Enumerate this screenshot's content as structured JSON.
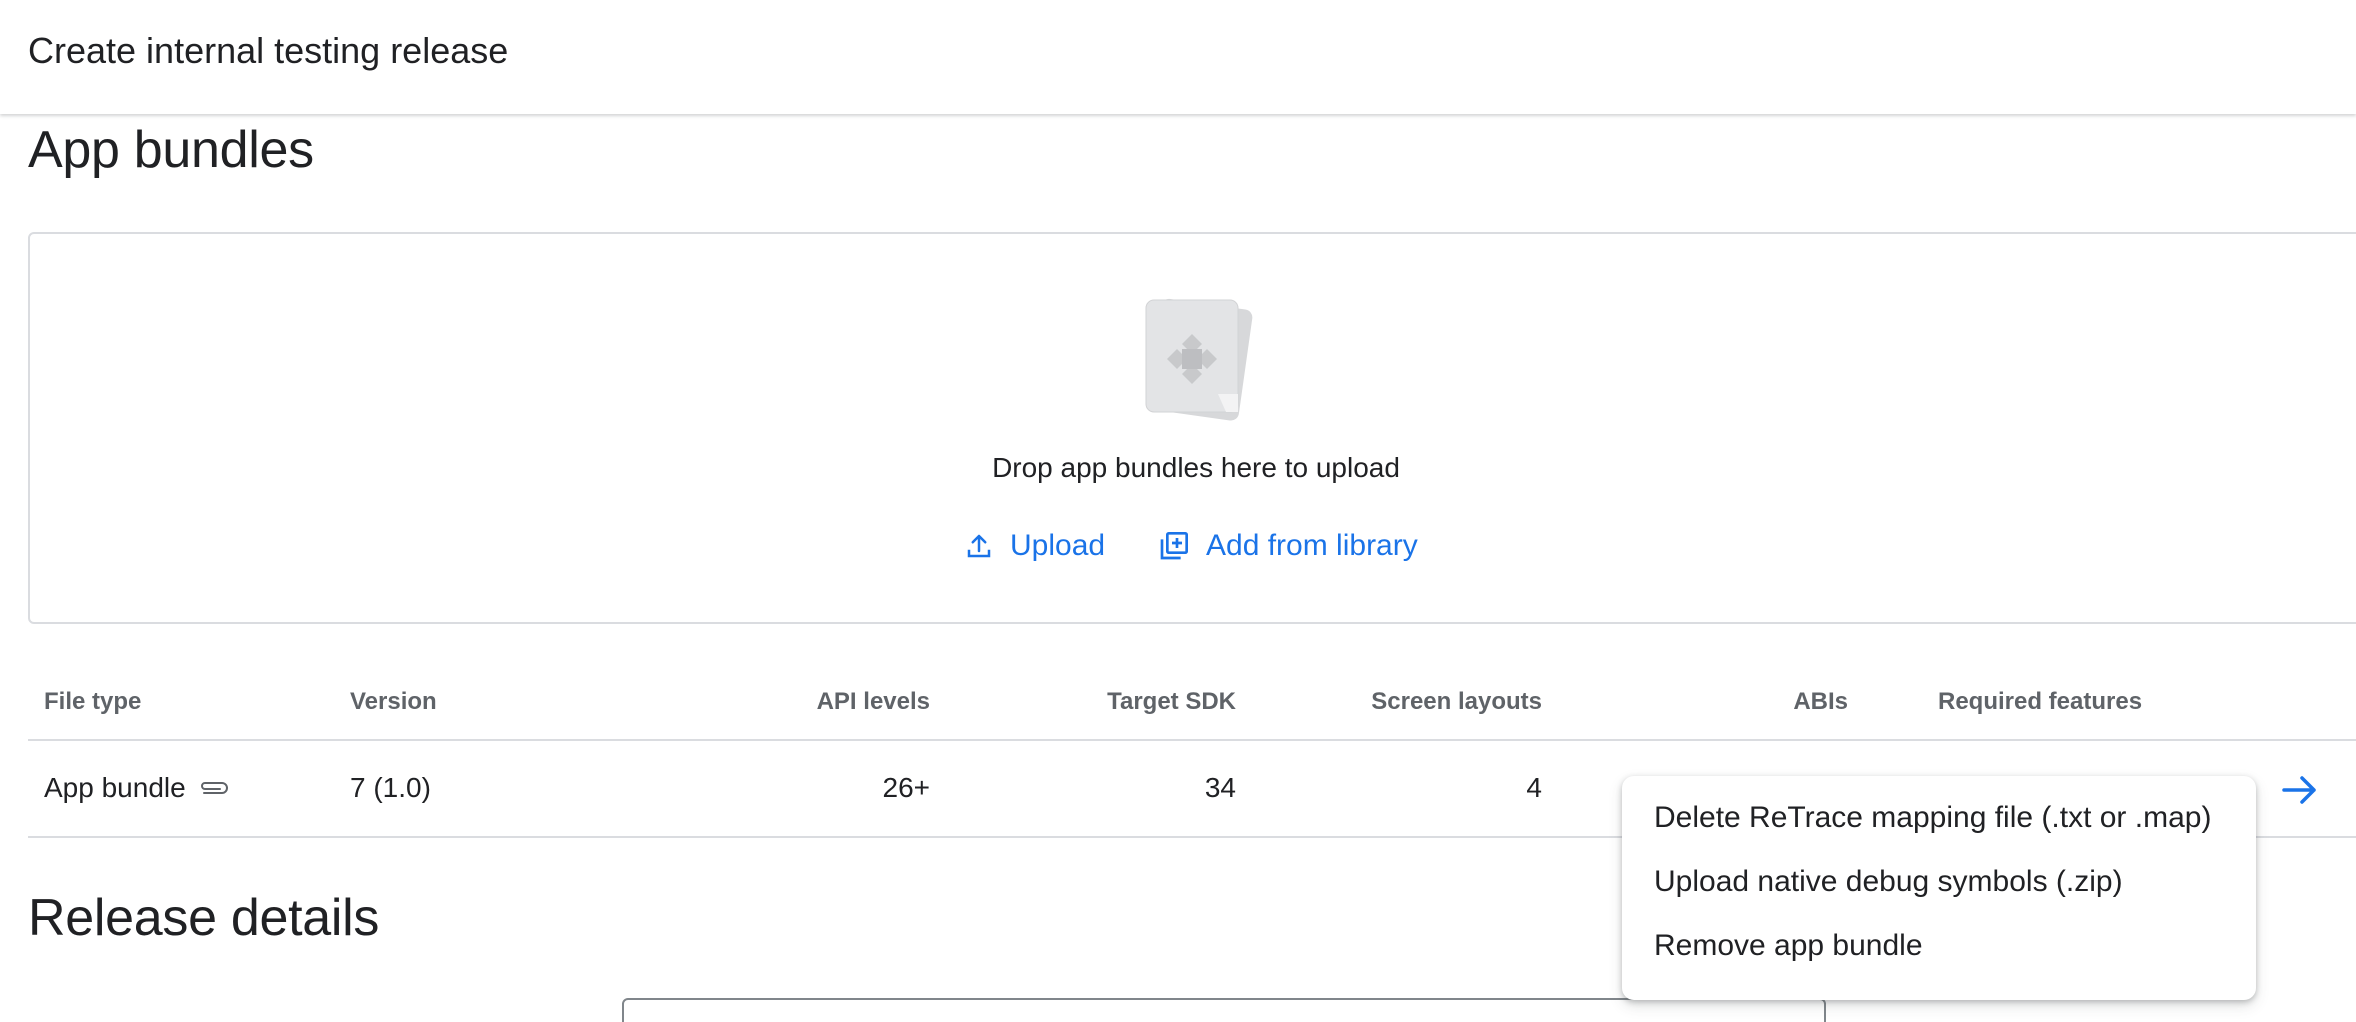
{
  "header": {
    "title": "Create internal testing release"
  },
  "sections": {
    "app_bundles": "App bundles",
    "release_details": "Release details"
  },
  "dropzone": {
    "icon": "app-bundle-file-icon",
    "text": "Drop app bundles here to upload",
    "upload_label": "Upload",
    "upload_icon": "upload-icon",
    "library_label": "Add from library",
    "library_icon": "library-add-icon"
  },
  "table": {
    "columns": [
      "File type",
      "Version",
      "API levels",
      "Target SDK",
      "Screen layouts",
      "ABIs",
      "Required features"
    ],
    "rows": [
      {
        "file_type": "App bundle",
        "file_icon": "attachment-icon",
        "version": "7 (1.0)",
        "api_levels": "26+",
        "target_sdk": "34",
        "screen_layouts": "4",
        "open_icon": "arrow-right-icon"
      }
    ]
  },
  "menu": {
    "items": [
      "Delete ReTrace mapping file (.txt or .map)",
      "Upload native debug symbols (.zip)",
      "Remove app bundle"
    ]
  },
  "colors": {
    "accent": "#1a73e8",
    "text": "#202124",
    "muted": "#5f6368",
    "divider": "#dadce0"
  }
}
